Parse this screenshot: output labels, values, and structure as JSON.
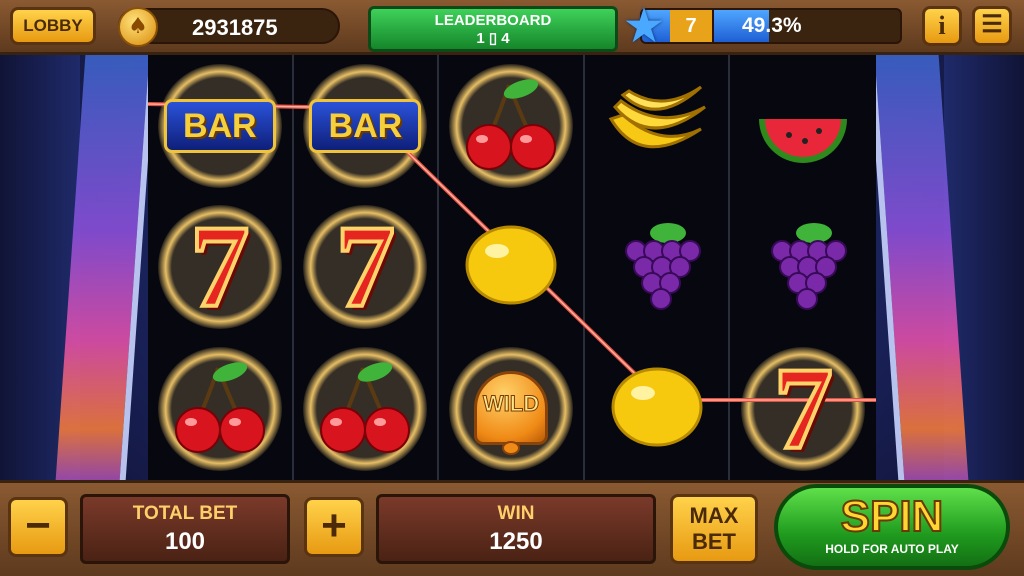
{
  "topbar": {
    "lobby_label": "LOBBY",
    "coin_icon": "spade-coin-icon",
    "coins": "2931875",
    "leaderboard_title": "LEADERBOARD",
    "leaderboard_sub": "1 ▯ 4",
    "level_icon": "star-icon",
    "level": "7",
    "level_progress": "49.3%",
    "level_progress_fraction": 0.493,
    "info_label": "i",
    "menu_icon": "menu-icon"
  },
  "reels": {
    "columns": [
      [
        "bar",
        "seven",
        "cherry"
      ],
      [
        "bar",
        "seven",
        "cherry"
      ],
      [
        "cherry",
        "lemon",
        "wild-bell"
      ],
      [
        "banana",
        "grapes",
        "lemon"
      ],
      [
        "watermelon",
        "grapes",
        "seven"
      ]
    ],
    "bar_label": "BAR",
    "seven_label": "7",
    "wild_label": "WILD"
  },
  "bottombar": {
    "minus_label": "−",
    "plus_label": "+",
    "total_bet_title": "TOTAL BET",
    "total_bet": "100",
    "win_title": "WIN",
    "win": "1250",
    "maxbet_line1": "MAX",
    "maxbet_line2": "BET",
    "spin_label": "SPIN",
    "spin_sub": "HOLD FOR AUTO PLAY"
  },
  "colors": {
    "accent_gold": "#ffd24a",
    "spin_green": "#1f9a1e",
    "payline": "#c0392b",
    "frame_brown": "#5e3a1e"
  }
}
